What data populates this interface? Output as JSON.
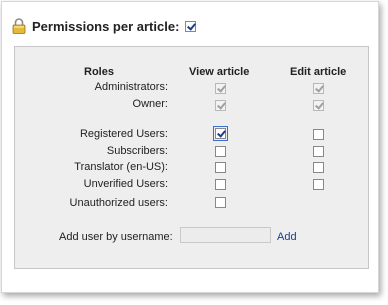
{
  "header": {
    "title": "Permissions per article:",
    "enabled": true
  },
  "columns": {
    "roles": "Roles",
    "view": "View article",
    "edit": "Edit article"
  },
  "rows": [
    {
      "label": "Administrators:",
      "view": "checked-disabled",
      "edit": "checked-disabled"
    },
    {
      "label": "Owner:",
      "view": "checked-disabled",
      "edit": "checked-disabled"
    },
    {
      "label": "Registered Users:",
      "view": "checked",
      "edit": "unchecked"
    },
    {
      "label": "Subscribers:",
      "view": "unchecked",
      "edit": "unchecked"
    },
    {
      "label": "Translator (en-US):",
      "view": "unchecked",
      "edit": "unchecked"
    },
    {
      "label": "Unverified Users:",
      "view": "unchecked",
      "edit": "unchecked"
    },
    {
      "label": "Unauthorized users:",
      "view": "unchecked",
      "edit": null
    }
  ],
  "add_user": {
    "label": "Add user by username:",
    "value": "",
    "link": "Add"
  },
  "icons": {
    "lock": "lock-icon"
  }
}
